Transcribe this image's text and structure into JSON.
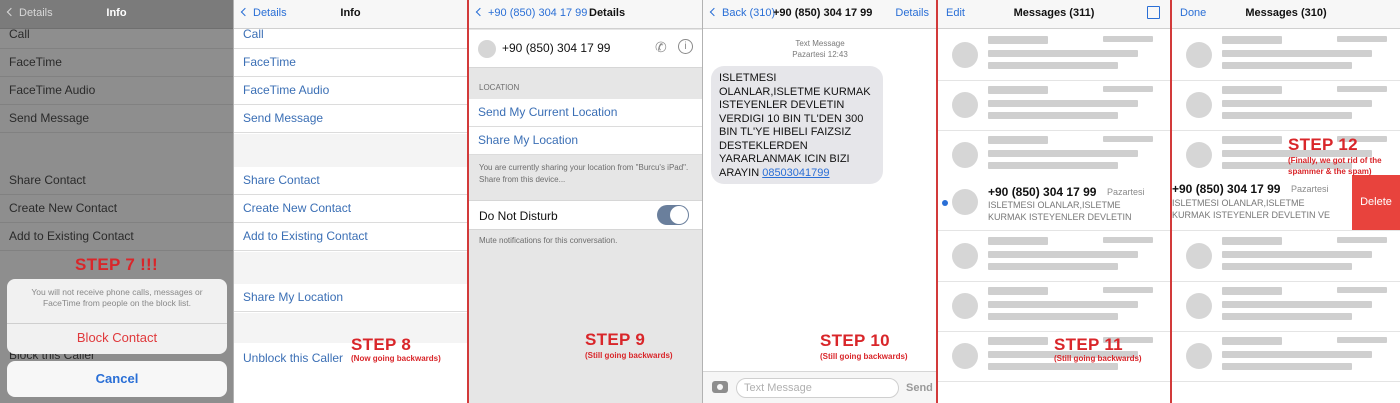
{
  "p1": {
    "back": "Details",
    "title": "Info",
    "rows": [
      "Call",
      "FaceTime",
      "FaceTime Audio",
      "Send Message",
      "Share Contact",
      "Create New Contact",
      "Add to Existing Contact",
      "Block this Caller"
    ],
    "step": "STEP 7 !!!",
    "sheet_text": "You will not receive phone calls, messages or FaceTime from people on the block list.",
    "block_btn": "Block Contact",
    "cancel_btn": "Cancel"
  },
  "p2": {
    "back": "Details",
    "title": "Info",
    "rows": [
      "Call",
      "FaceTime",
      "FaceTime Audio",
      "Send Message",
      "Share Contact",
      "Create New Contact",
      "Add to Existing Contact",
      "Share My Location",
      "Unblock this Caller"
    ],
    "step": "STEP 8",
    "sub": "(Now going backwards)"
  },
  "p3": {
    "back": "+90 (850) 304 17 99",
    "title": "Details",
    "number": "+90 (850) 304 17 99",
    "location_header": "LOCATION",
    "send_loc": "Send My Current Location",
    "share_loc": "Share My Location",
    "share_note": "You are currently sharing your location from \"Burcu's iPad\". Share from this device...",
    "dnd": "Do Not Disturb",
    "dnd_note": "Mute notifications for this conversation.",
    "step": "STEP 9",
    "sub": "(Still going backwards)"
  },
  "p4": {
    "back": "Back (310)",
    "title": "+90 (850) 304 17 99",
    "right": "Details",
    "meta1": "Text Message",
    "meta2": "Pazartesi 12:43",
    "bubble": "ISLETMESI OLANLAR,ISLETME KURMAK ISTEYENLER DEVLETIN VERDIGI 10 BIN TL'DEN 300 BIN TL'YE HIBELI FAIZSIZ DESTEKLERDEN YARARLANMAK ICIN BIZI ARAYIN",
    "link": "08503041799",
    "input_ph": "Text Message",
    "send": "Send",
    "step": "STEP 10",
    "sub": "(Still going backwards)"
  },
  "p5": {
    "left": "Edit",
    "title": "Messages (311)",
    "number": "+90 (850) 304 17 99",
    "day": "Pazartesi",
    "preview": "ISLETMESI OLANLAR,ISLETME KURMAK ISTEYENLER DEVLETIN VER...",
    "step": "STEP 11",
    "sub": "(Still going backwards)"
  },
  "p6": {
    "left": "Done",
    "title": "Messages (310)",
    "number": "+90 (850) 304 17 99",
    "day": "Pazartesi",
    "preview": "ISLETMESI OLANLAR,ISLETME KURMAK ISTEYENLER DEVLETIN VE",
    "delete": "Delete",
    "step": "STEP 12",
    "sub": "(Finally, we got rid of the spammer & the spam)"
  },
  "colors": {
    "ios_blue": "#2a6fd6",
    "step_red": "#d9262a",
    "delete_red": "#e8433d",
    "toggle": "#6a7f9c"
  }
}
